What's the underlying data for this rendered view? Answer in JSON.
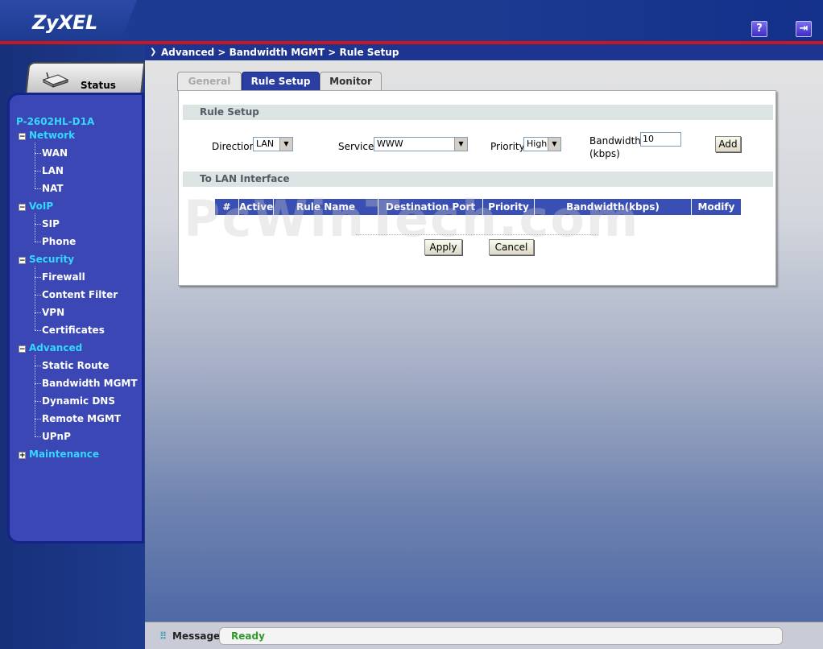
{
  "header": {
    "logo": "ZyXEL",
    "help_icon": "?",
    "logout_icon": "⇥"
  },
  "sidebar": {
    "status_label": "Status",
    "device": "P-2602HL-D1A",
    "groups": {
      "network": {
        "label": "Network",
        "toggle": "−",
        "items": [
          "WAN",
          "LAN",
          "NAT"
        ]
      },
      "voip": {
        "label": "VoIP",
        "toggle": "−",
        "items": [
          "SIP",
          "Phone"
        ]
      },
      "security": {
        "label": "Security",
        "toggle": "−",
        "items": [
          "Firewall",
          "Content Filter",
          "VPN",
          "Certificates"
        ]
      },
      "advanced": {
        "label": "Advanced",
        "toggle": "−",
        "items": [
          "Static Route",
          "Bandwidth MGMT",
          "Dynamic DNS",
          "Remote MGMT",
          "UPnP"
        ]
      },
      "maintenance": {
        "label": "Maintenance",
        "toggle": "+"
      }
    }
  },
  "main": {
    "breadcrumb": "Advanced > Bandwidth MGMT > Rule Setup",
    "tabs": {
      "general": "General",
      "rule_setup": "Rule Setup",
      "monitor": "Monitor"
    },
    "rule_setup": {
      "section_title": "Rule Setup",
      "direction_label": "Direction",
      "direction_value": "LAN",
      "service_label": "Service",
      "service_value": "WWW",
      "priority_label": "Priority",
      "priority_value": "High",
      "bandwidth_label": "Bandwidth",
      "bandwidth_unit": "(kbps)",
      "bandwidth_value": "10",
      "add_button": "Add"
    },
    "lan_interface": {
      "section_title": "To LAN Interface",
      "columns": [
        "#",
        "Active",
        "Rule Name",
        "Destination Port",
        "Priority",
        "Bandwidth(kbps)",
        "Modify"
      ]
    },
    "apply_button": "Apply",
    "cancel_button": "Cancel",
    "watermark": "PcWinTech.com"
  },
  "statusbar": {
    "label": "Message",
    "value": "Ready"
  }
}
